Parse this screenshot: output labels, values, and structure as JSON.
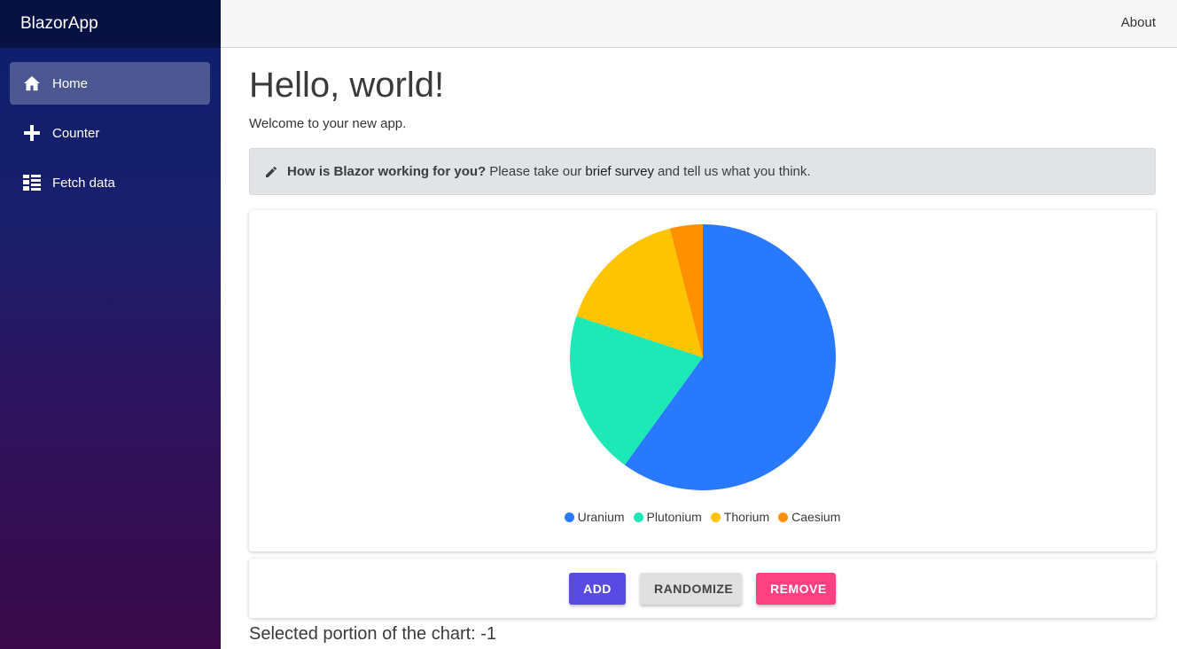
{
  "sidebar": {
    "brand": "BlazorApp",
    "items": [
      {
        "label": "Home",
        "icon": "home-icon",
        "active": true
      },
      {
        "label": "Counter",
        "icon": "plus-icon",
        "active": false
      },
      {
        "label": "Fetch data",
        "icon": "list-icon",
        "active": false
      }
    ]
  },
  "topbar": {
    "about": "About"
  },
  "main": {
    "title": "Hello, world!",
    "welcome": "Welcome to your new app.",
    "survey": {
      "bold": "How is Blazor working for you?",
      "before": "Please take our",
      "link": "brief survey",
      "after": "and tell us what you think."
    },
    "buttons": {
      "add": "ADD",
      "randomize": "RANDOMIZE",
      "remove": "REMOVE"
    },
    "selected_text": "Selected portion of the chart: -1"
  },
  "colors": {
    "primary": "#594ae2",
    "secondary": "#ff4081",
    "uranium": "#2979ff",
    "plutonium": "#1de9b6",
    "thorium": "#ffc400",
    "caesium": "#ff9100"
  },
  "chart_data": {
    "type": "pie",
    "categories": [
      "Uranium",
      "Plutonium",
      "Thorium",
      "Caesium"
    ],
    "values": [
      60,
      20,
      16,
      4
    ],
    "colors": [
      "#2979ff",
      "#1de9b6",
      "#ffc400",
      "#ff9100"
    ],
    "legend": "bottom"
  }
}
